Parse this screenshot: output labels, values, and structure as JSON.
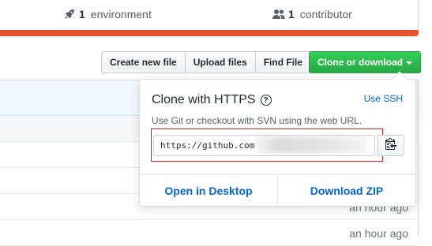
{
  "stats": {
    "environments": {
      "count": "1",
      "label": "environment",
      "icon": "rocket-icon"
    },
    "contributors": {
      "count": "1",
      "label": "contributor",
      "icon": "people-icon"
    }
  },
  "toolbar": {
    "create_new_file": "Create new file",
    "upload_files": "Upload files",
    "find_file": "Find File",
    "clone_or_download": "Clone or download"
  },
  "clone_panel": {
    "title": "Clone with HTTPS",
    "use_ssh": "Use SSH",
    "description": "Use Git or checkout with SVN using the web URL.",
    "url_value": "https://github.com",
    "open_in_desktop": "Open in Desktop",
    "download_zip": "Download ZIP"
  },
  "file_list": {
    "ages": [
      "an hour ago",
      "an hour ago"
    ]
  },
  "colors": {
    "accent_orange": "#e8532d",
    "clone_green": "#28a745",
    "link_blue": "#0366d6",
    "highlight_red": "#d0202a"
  }
}
